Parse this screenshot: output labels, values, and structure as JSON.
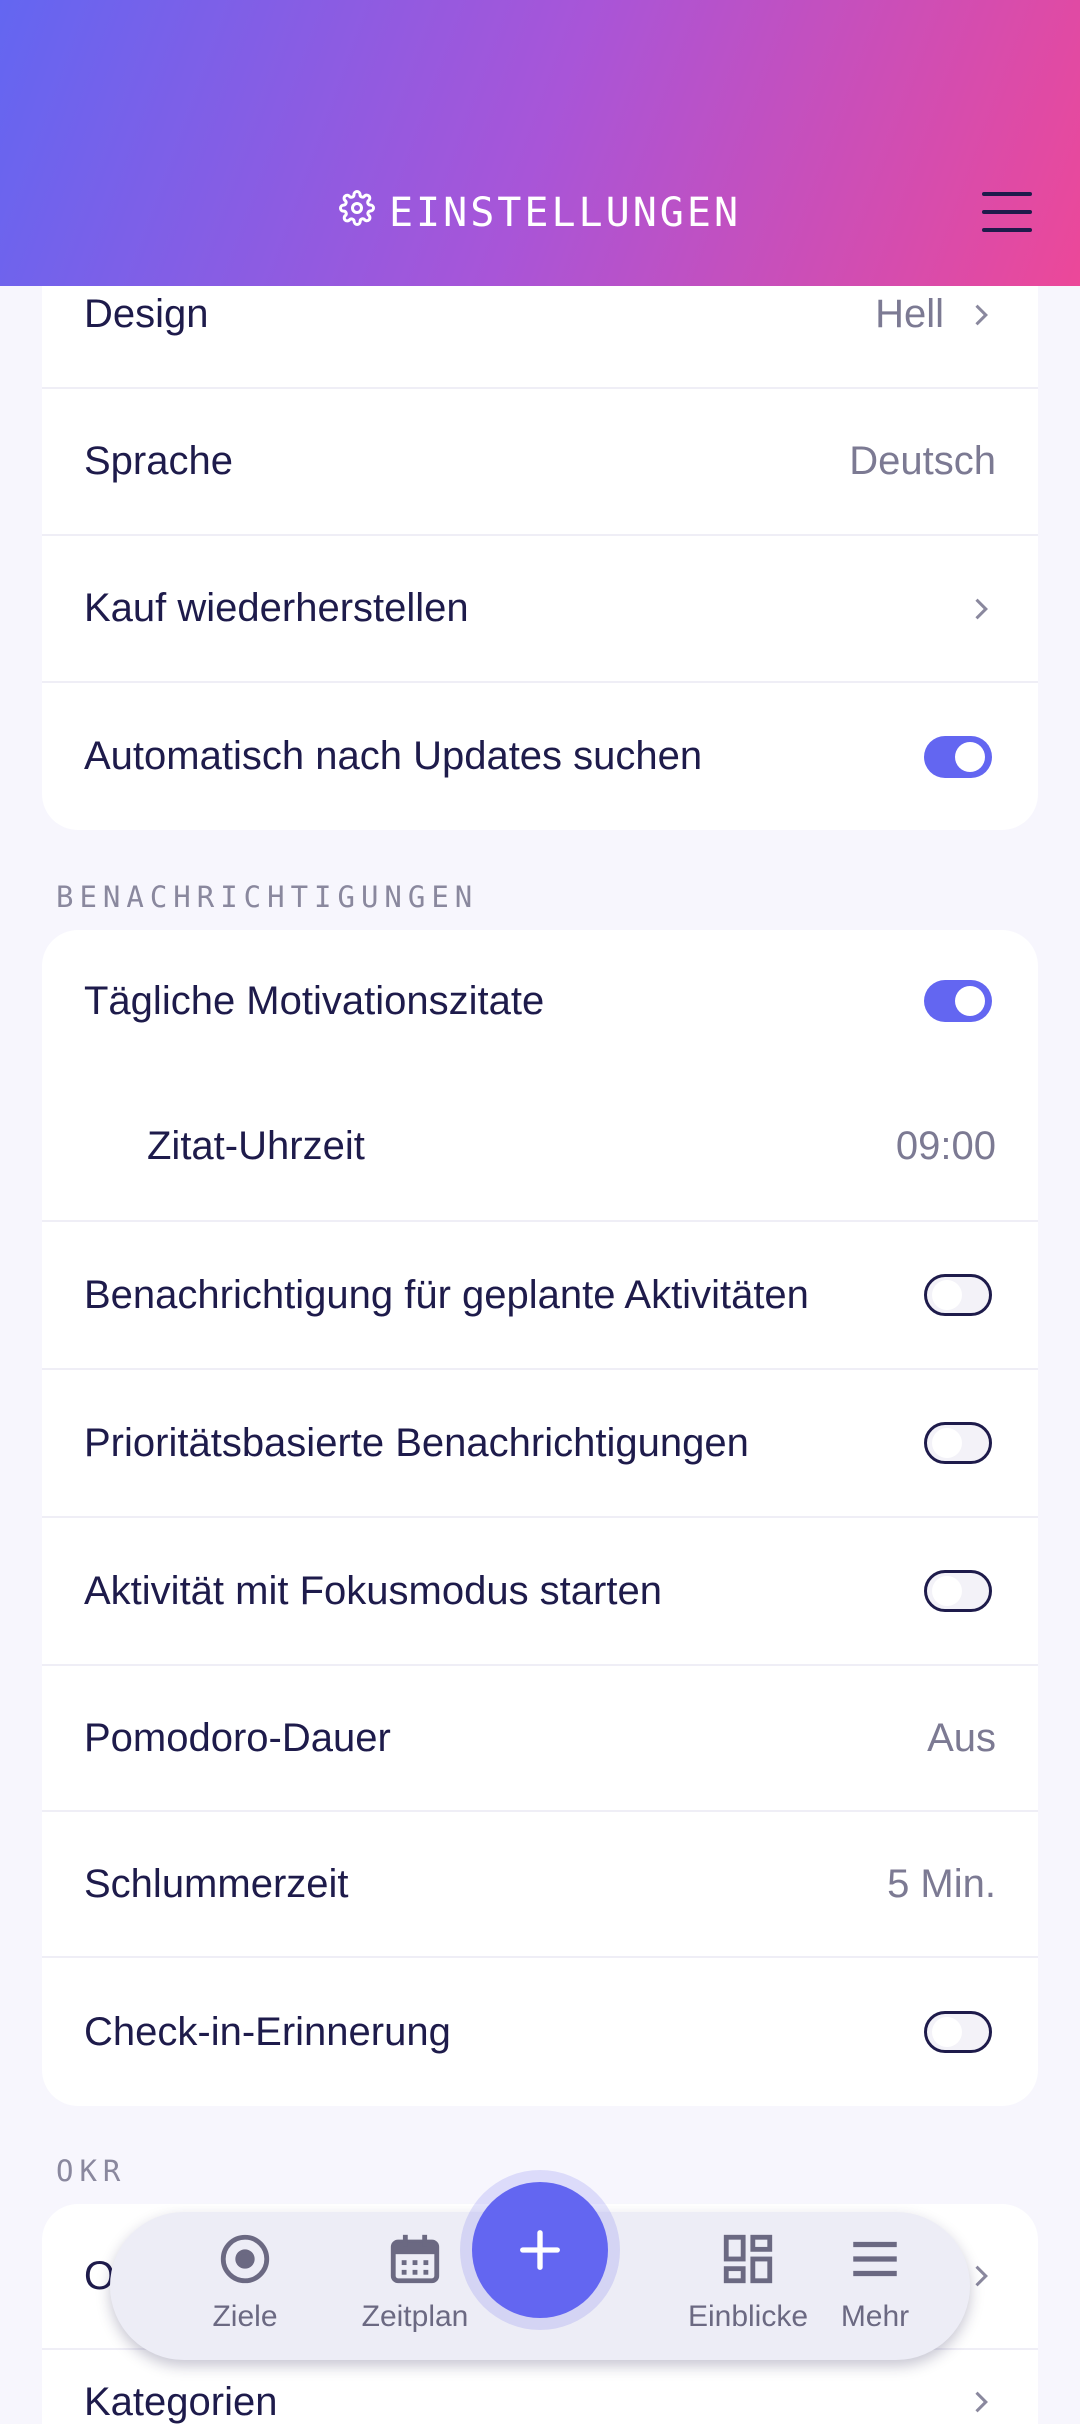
{
  "header": {
    "title": "EINSTELLUNGEN",
    "title_icon": "gear-icon",
    "menu_icon": "hamburger-menu-icon"
  },
  "general": {
    "rows": [
      {
        "label": "Design",
        "value": "Hell"
      },
      {
        "label": "Sprache",
        "value": "Deutsch"
      },
      {
        "label": "Kauf wiederherstellen"
      },
      {
        "label": "Automatisch nach Updates suchen",
        "toggle": true
      }
    ]
  },
  "notifications": {
    "section_title": "BENACHRICHTIGUNGEN",
    "rows": [
      {
        "label": "Tägliche Motivationszitate",
        "toggle": true
      },
      {
        "label": "Zitat-Uhrzeit",
        "value": "09:00"
      },
      {
        "label": "Benachrichtigung für geplante Aktivitäten",
        "toggle": false
      },
      {
        "label": "Prioritätsbasierte Benachrichtigungen",
        "toggle": false
      },
      {
        "label": "Aktivität mit Fokusmodus starten",
        "toggle": false
      },
      {
        "label": "Pomodoro-Dauer",
        "value": "Aus"
      },
      {
        "label": "Schlummerzeit",
        "value": "5 Min."
      },
      {
        "label": "Check-in-Erinnerung",
        "toggle": false
      }
    ]
  },
  "okr": {
    "section_title": "OKR",
    "rows": [
      {
        "label": "O"
      },
      {
        "label": "Kategorien"
      }
    ]
  },
  "bottom_nav": {
    "items": [
      {
        "label": "Ziele",
        "icon": "target-icon"
      },
      {
        "label": "Zeitplan",
        "icon": "calendar-icon"
      },
      {
        "label": "Einblicke",
        "icon": "dashboard-icon"
      },
      {
        "label": "Mehr",
        "icon": "menu-icon"
      }
    ],
    "fab_icon": "plus-icon"
  },
  "colors": {
    "accent": "#6366f1",
    "gradient_start": "#6366f1",
    "gradient_end": "#ec4899",
    "text": "#1e1b4b"
  }
}
